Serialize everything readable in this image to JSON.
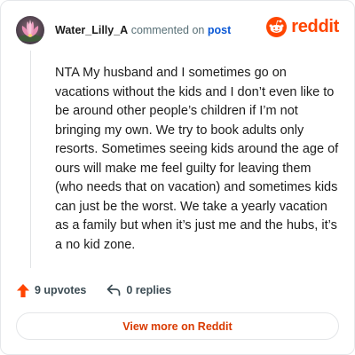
{
  "comment": {
    "username": "Water_Lilly_A",
    "action_text": "commented on",
    "post_link_label": "post",
    "body": "NTA My husband and I sometimes go on vacations without the kids and I don’t even like to be around other people’s children if I’m not bringing my own. We try to book adults only resorts. Sometimes seeing kids around the age of ours will make me feel guilty for leaving them (who needs that on vacation) and sometimes kids can just be the worst. We take a yearly vacation as a family but when it’s just me and the hubs, it’s a no kid zone."
  },
  "brand": {
    "name": "reddit",
    "icon": "reddit-snoo-icon",
    "color": "#ff4500"
  },
  "avatar": {
    "icon": "lotus-flower-avatar"
  },
  "actions": {
    "upvotes_label": "9 upvotes",
    "upvote_icon": "upvote-arrow-icon",
    "replies_label": "0 replies",
    "reply_icon": "reply-arrow-icon"
  },
  "cta": {
    "view_label": "View more on Reddit"
  },
  "colors": {
    "accent": "#ff4500",
    "link": "#0a58d6",
    "cta_text": "#d93a00"
  }
}
